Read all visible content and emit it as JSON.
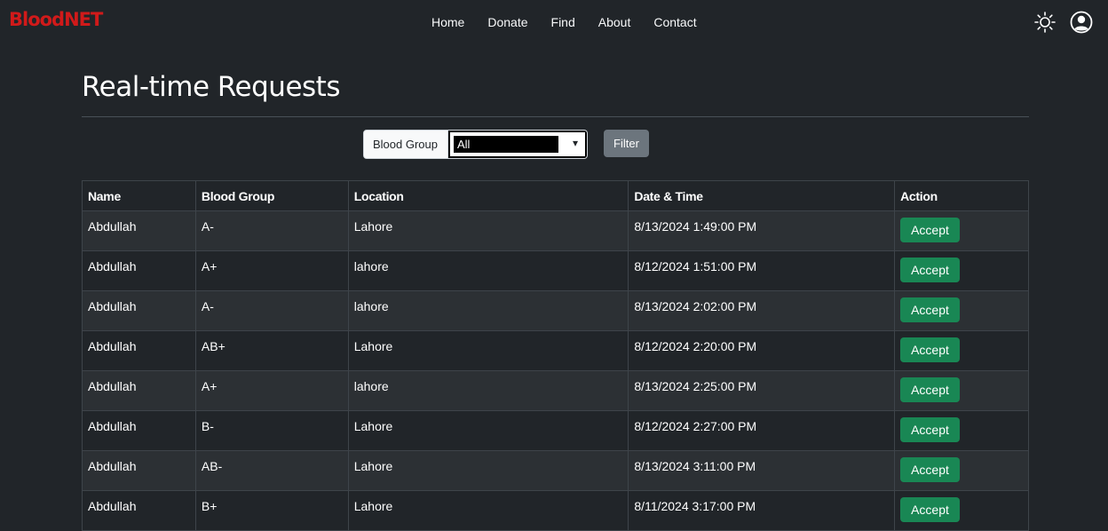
{
  "brand": "BloodNET",
  "nav": {
    "links": [
      "Home",
      "Donate",
      "Find",
      "About",
      "Contact"
    ],
    "theme_icon": "sun-icon",
    "profile_icon": "user-circle-icon"
  },
  "page": {
    "title": "Real-time Requests"
  },
  "filter": {
    "label": "Blood Group",
    "selected": "All",
    "button": "Filter"
  },
  "table": {
    "headers": [
      "Name",
      "Blood Group",
      "Location",
      "Date & Time",
      "Action"
    ],
    "rows": [
      {
        "name": "Abdullah",
        "blood_group": "A-",
        "location": "Lahore",
        "datetime": "8/13/2024 1:49:00 PM",
        "action": "Accept"
      },
      {
        "name": "Abdullah",
        "blood_group": "A+",
        "location": "lahore",
        "datetime": "8/12/2024 1:51:00 PM",
        "action": "Accept"
      },
      {
        "name": "Abdullah",
        "blood_group": "A-",
        "location": "lahore",
        "datetime": "8/13/2024 2:02:00 PM",
        "action": "Accept"
      },
      {
        "name": "Abdullah",
        "blood_group": "AB+",
        "location": "Lahore",
        "datetime": "8/12/2024 2:20:00 PM",
        "action": "Accept"
      },
      {
        "name": "Abdullah",
        "blood_group": "A+",
        "location": "lahore",
        "datetime": "8/13/2024 2:25:00 PM",
        "action": "Accept"
      },
      {
        "name": "Abdullah",
        "blood_group": "B-",
        "location": "Lahore",
        "datetime": "8/12/2024 2:27:00 PM",
        "action": "Accept"
      },
      {
        "name": "Abdullah",
        "blood_group": "AB-",
        "location": "Lahore",
        "datetime": "8/13/2024 3:11:00 PM",
        "action": "Accept"
      },
      {
        "name": "Abdullah",
        "blood_group": "B+",
        "location": "Lahore",
        "datetime": "8/11/2024 3:17:00 PM",
        "action": "Accept"
      }
    ]
  },
  "colors": {
    "background": "#212529",
    "brand": "#d11a1a",
    "accept": "#198754",
    "filter_button": "#6c757d"
  }
}
